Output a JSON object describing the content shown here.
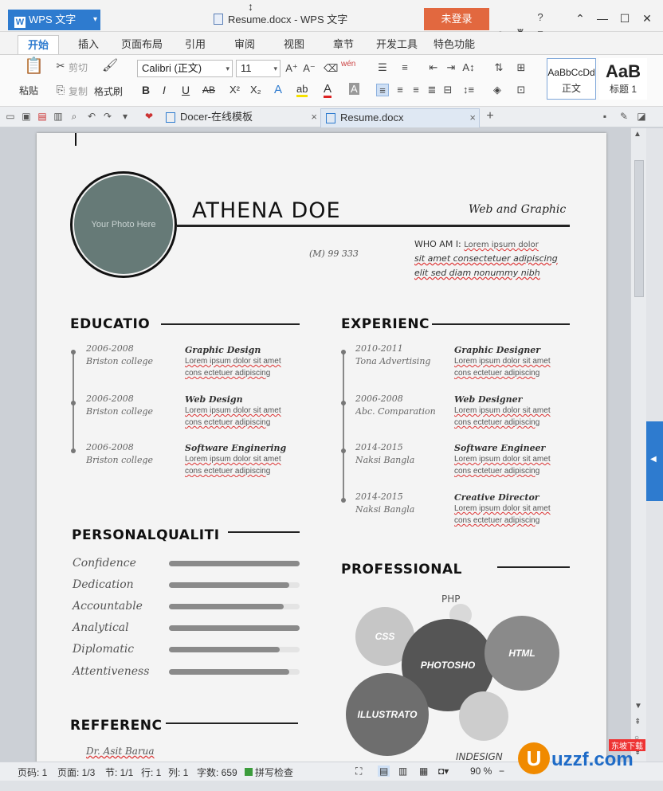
{
  "titlebar": {
    "app_button": "WPS 文字",
    "app_logo": "W",
    "doc_title": "Resume.docx - WPS 文字",
    "login": "未登录",
    "help": "?"
  },
  "menu_tabs": [
    "开始",
    "插入",
    "页面布局",
    "引用",
    "审阅",
    "视图",
    "章节",
    "开发工具",
    "特色功能"
  ],
  "ribbon": {
    "paste": "粘贴",
    "cut": "剪切",
    "copy": "复制",
    "format_painter": "格式刷",
    "font": "Calibri (正文)",
    "size": "11",
    "bold": "B",
    "italic": "I",
    "underline": "U",
    "strike": "AB",
    "superscript": "X²",
    "subscript": "X₂",
    "text_effect": "A",
    "highlight": "ab",
    "font_color": "A",
    "char_shading": "A",
    "pinyin": "wén",
    "style_normal_preview": "AaBbCcDd",
    "style_normal_label": "正文",
    "style_h1_preview": "AaB",
    "style_h1_label": "标题 1"
  },
  "doc_tabs": [
    {
      "label": "Docer-在线模板",
      "active": false
    },
    {
      "label": "Resume.docx",
      "active": true
    }
  ],
  "resume": {
    "photo": "Your Photo Here",
    "name": "ATHENA DOE",
    "tagline": "Web and Graphic",
    "phone": "(M) 99 333",
    "who_am_i_label": "WHO AM I:",
    "who_am_i_text": [
      "Lorem ipsum dolor",
      "sit amet consectetuer adipiscing",
      "elit sed diam nonummy nibh"
    ],
    "education_heading": "EDUCATIO",
    "education": [
      {
        "date": "2006-2008",
        "org": "Briston college",
        "title": "Graphic Design"
      },
      {
        "date": "2006-2008",
        "org": "Briston college",
        "title": "Web Design"
      },
      {
        "date": "2006-2008",
        "org": "Briston college",
        "title": "Software Enginering"
      }
    ],
    "experience_heading": "EXPERIENC",
    "experience": [
      {
        "date": "2010-2011",
        "org": "Tona Advertising",
        "title": "Graphic Designer"
      },
      {
        "date": "2006-2008",
        "org": "Abc. Comparation",
        "title": "Web Designer"
      },
      {
        "date": "2014-2015",
        "org": "Naksi Bangla",
        "title": "Software Engineer"
      },
      {
        "date": "2014-2015",
        "org": "Naksi Bangla",
        "title": "Creative Director"
      }
    ],
    "lorem_line1": "Lorem ipsum dolor sit amet",
    "lorem_line2": "cons  ectetuer  adipiscing",
    "personal_heading": "PERSONALQUALITI",
    "qualities": [
      {
        "label": "Confidence",
        "level": 1.0
      },
      {
        "label": "Dedication",
        "level": 0.92
      },
      {
        "label": "Accountable",
        "level": 0.88
      },
      {
        "label": "Analytical",
        "level": 1.0
      },
      {
        "label": "Diplomatic",
        "level": 0.85
      },
      {
        "label": "Attentiveness",
        "level": 0.92
      }
    ],
    "professional_heading": "PROFESSIONAL",
    "skills": {
      "php": "PHP",
      "css": "CSS",
      "photoshop": "PHOTOSHO",
      "html": "HTML",
      "illustrator": "ILLUSTRATO",
      "indesign": "INDESIGN"
    },
    "reference_heading": "REFFERENC",
    "reference_name": "Dr. Asit Barua"
  },
  "statusbar": {
    "page_num": "页码: 1",
    "pages": "页面: 1/3",
    "section": "节: 1/1",
    "row": "行: 1",
    "col": "列: 1",
    "words": "字数: 659",
    "spell": "拼写检查",
    "zoom": "90 %"
  },
  "watermark": "uzzf.com",
  "watermark_tag": "东坡下载",
  "colors": {
    "accent": "#2e7bcf",
    "login": "#e2683f",
    "photo": "#667a77"
  }
}
